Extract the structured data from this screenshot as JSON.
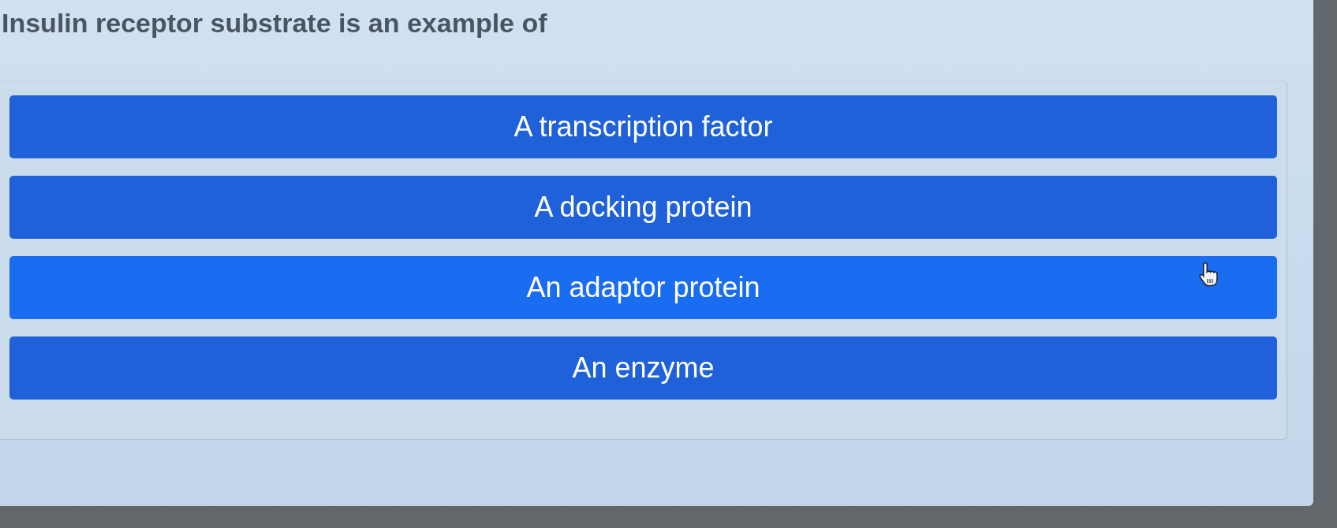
{
  "question": {
    "text": "Insulin receptor substrate is an example of"
  },
  "options": [
    {
      "label": "A transcription factor",
      "hovered": false
    },
    {
      "label": "A docking protein",
      "hovered": false
    },
    {
      "label": "An adaptor protein",
      "hovered": true
    },
    {
      "label": "An enzyme",
      "hovered": false
    }
  ]
}
